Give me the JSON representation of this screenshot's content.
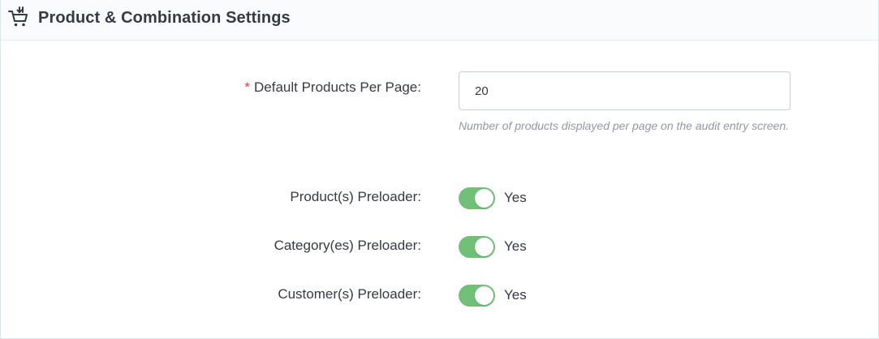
{
  "header": {
    "title": "Product & Combination Settings",
    "icon": "shopping-cart-icon"
  },
  "form": {
    "products_per_page": {
      "required_mark": "*",
      "label": "Default Products Per Page:",
      "value": "20",
      "help": "Number of products displayed per page on the audit entry screen."
    },
    "product_preloader": {
      "label": "Product(s) Preloader:",
      "enabled": true,
      "state_label": "Yes"
    },
    "category_preloader": {
      "label": "Category(es) Preloader:",
      "enabled": true,
      "state_label": "Yes"
    },
    "customer_preloader": {
      "label": "Customer(s) Preloader:",
      "enabled": true,
      "state_label": "Yes"
    }
  },
  "colors": {
    "switch_on": "#70c078",
    "required": "#e53935",
    "help_text": "#8f9aa0"
  }
}
